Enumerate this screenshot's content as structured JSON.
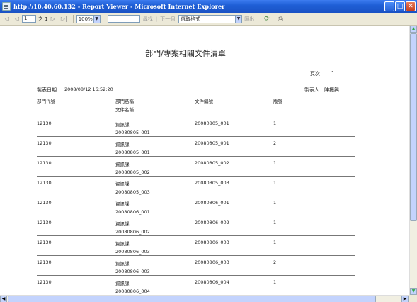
{
  "window": {
    "title": "http://10.40.60.132 - Report Viewer - Microsoft Internet Explorer",
    "buttons": {
      "minimize": "_",
      "maximize": "□",
      "close": "✕"
    }
  },
  "toolbar": {
    "page_input": "1",
    "page_of": "之 1",
    "zoom": "100%",
    "find_placeholder": "",
    "find_label": "尋找",
    "separator": "|",
    "next_label": "下一個",
    "format_select": "選取格式",
    "export_label": "匯出"
  },
  "report": {
    "title": "部門/專案相關文件清單",
    "page_label": "頁次",
    "page_number": "1",
    "date_label": "製表日期",
    "date_value": "2008/08/12 16:52:20",
    "maker_label": "製表人",
    "maker_value": "陳振興",
    "headers": {
      "dept_code": "部門代號",
      "dept_name": "部門名稱",
      "doc_name": "文件名稱",
      "doc_number": "文件編號",
      "version": "版號"
    },
    "rows": [
      {
        "dept_code": "12130",
        "dept_name": "資訊課",
        "doc_name": "20080805_001",
        "doc_number": "20080805_001",
        "version": "1"
      },
      {
        "dept_code": "12130",
        "dept_name": "資訊課",
        "doc_name": "20080805_001",
        "doc_number": "20080805_001",
        "version": "2"
      },
      {
        "dept_code": "12130",
        "dept_name": "資訊課",
        "doc_name": "20080805_002",
        "doc_number": "20080805_002",
        "version": "1"
      },
      {
        "dept_code": "12130",
        "dept_name": "資訊課",
        "doc_name": "20080805_003",
        "doc_number": "20080805_003",
        "version": "1"
      },
      {
        "dept_code": "12130",
        "dept_name": "資訊課",
        "doc_name": "20080806_001",
        "doc_number": "20080806_001",
        "version": "1"
      },
      {
        "dept_code": "12130",
        "dept_name": "資訊課",
        "doc_name": "20080806_002",
        "doc_number": "20080806_002",
        "version": "1"
      },
      {
        "dept_code": "12130",
        "dept_name": "資訊課",
        "doc_name": "20080806_003",
        "doc_number": "20080806_003",
        "version": "1"
      },
      {
        "dept_code": "12130",
        "dept_name": "資訊課",
        "doc_name": "20080806_003",
        "doc_number": "20080806_003",
        "version": "2"
      },
      {
        "dept_code": "12130",
        "dept_name": "資訊課",
        "doc_name": "20080806_004",
        "doc_number": "20080806_004",
        "version": "1"
      }
    ]
  }
}
